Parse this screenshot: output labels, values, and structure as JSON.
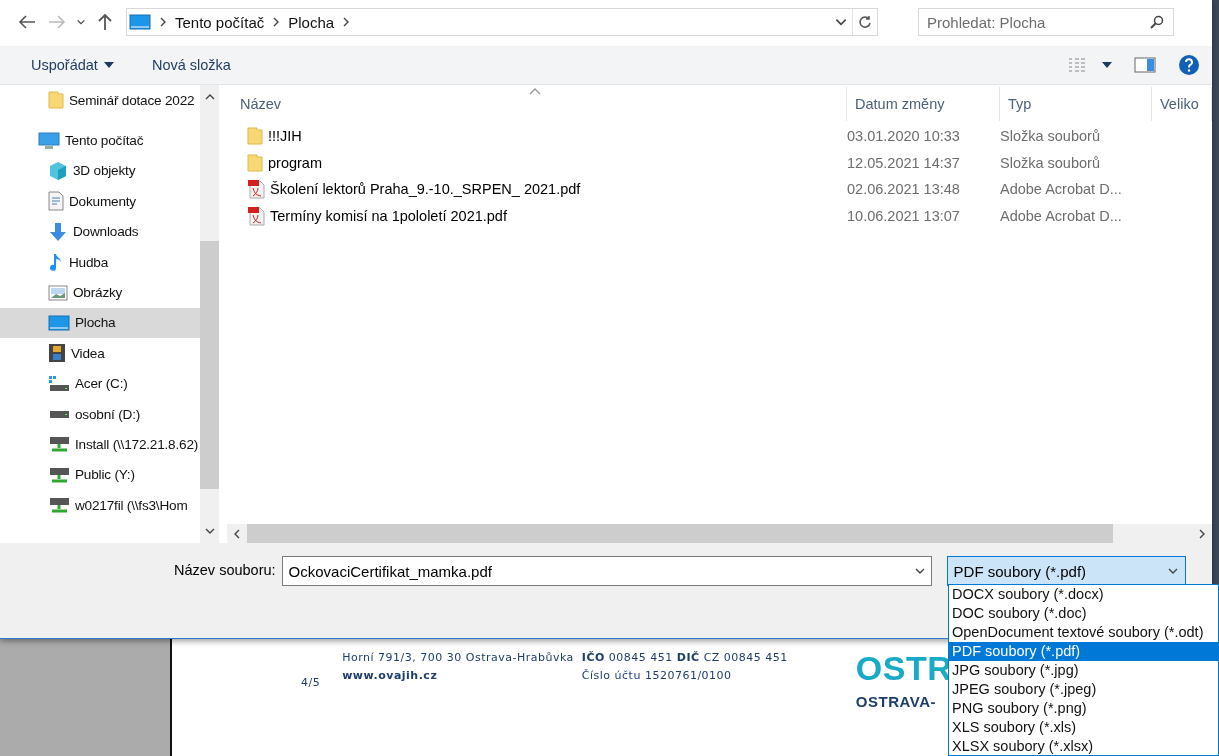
{
  "nav": {
    "breadcrumb": [
      "Tento počítač",
      "Plocha"
    ],
    "search": {
      "placeholder": "Prohledat: Plocha"
    }
  },
  "toolbar": {
    "organize": "Uspořádat",
    "new_folder": "Nová složka"
  },
  "sidebar": {
    "quick_access": [
      {
        "label": "Seminář dotace 2022",
        "kind": "folder",
        "selected": false
      }
    ],
    "this_pc": {
      "label": "Tento počítač",
      "kind": "pc",
      "selected": false,
      "children": [
        {
          "label": "3D objekty",
          "kind": "cube",
          "selected": false
        },
        {
          "label": "Dokumenty",
          "kind": "document",
          "selected": false
        },
        {
          "label": "Downloads",
          "kind": "download",
          "selected": false
        },
        {
          "label": "Hudba",
          "kind": "music",
          "selected": false
        },
        {
          "label": "Obrázky",
          "kind": "pictures",
          "selected": false
        },
        {
          "label": "Plocha",
          "kind": "desktop",
          "selected": true
        },
        {
          "label": "Videa",
          "kind": "video",
          "selected": false
        },
        {
          "label": "Acer (C:)",
          "kind": "system-drive",
          "selected": false
        },
        {
          "label": "osobní (D:)",
          "kind": "drive",
          "selected": false
        },
        {
          "label": "Install (\\\\172.21.8.62)",
          "kind": "network-drive",
          "selected": false
        },
        {
          "label": "Public (Y:)",
          "kind": "network-drive",
          "selected": false
        },
        {
          "label": "w0217fil (\\\\fs3\\Hom",
          "kind": "network-drive",
          "selected": false
        }
      ]
    }
  },
  "columns": [
    {
      "label": "Název",
      "sorted": true
    },
    {
      "label": "Datum změny",
      "sorted": false
    },
    {
      "label": "Typ",
      "sorted": false
    },
    {
      "label": "Veliko",
      "sorted": false
    }
  ],
  "files": [
    {
      "name": "!!!JIH",
      "date": "03.01.2020 10:33",
      "type": "Složka souborů",
      "kind": "folder"
    },
    {
      "name": "program",
      "date": "12.05.2021 14:37",
      "type": "Složka souborů",
      "kind": "folder"
    },
    {
      "name": "Školení lektorů Praha_9.-10._SRPEN_ 2021.pdf",
      "date": "02.06.2021 13:48",
      "type": "Adobe Acrobat D...",
      "kind": "pdf"
    },
    {
      "name": "Termíny komisí na 1pololetí 2021.pdf",
      "date": "10.06.2021 13:07",
      "type": "Adobe Acrobat D...",
      "kind": "pdf"
    }
  ],
  "save": {
    "filename_label": "Název souboru:",
    "filename": "OckovaciCertifikat_mamka.pdf",
    "file_type": "PDF soubory (*.pdf)",
    "file_type_options": [
      {
        "label": "DOCX soubory (*.docx)",
        "selected": false
      },
      {
        "label": "DOC soubory (*.doc)",
        "selected": false
      },
      {
        "label": "OpenDocument textové soubory (*.odt)",
        "selected": false
      },
      {
        "label": "PDF soubory (*.pdf)",
        "selected": true
      },
      {
        "label": "JPG soubory (*.jpg)",
        "selected": false
      },
      {
        "label": "JPEG soubory (*.jpeg)",
        "selected": false
      },
      {
        "label": "PNG soubory (*.png)",
        "selected": false
      },
      {
        "label": "XLS soubory (*.xls)",
        "selected": false
      },
      {
        "label": "XLSX soubory (*.xlsx)",
        "selected": false
      }
    ]
  },
  "document": {
    "page_number": "4/5",
    "address": "Horní 791/3, 700 30 Ostrava-Hrabůvka",
    "web": "www.ovajih.cz",
    "ids": "**IČO** 00845 451 **DIČ** CZ 00845 451",
    "account": "Číslo účtu 1520761/0100",
    "logo": "OSTR",
    "logo_subtitle": "OSTRAVA-"
  }
}
